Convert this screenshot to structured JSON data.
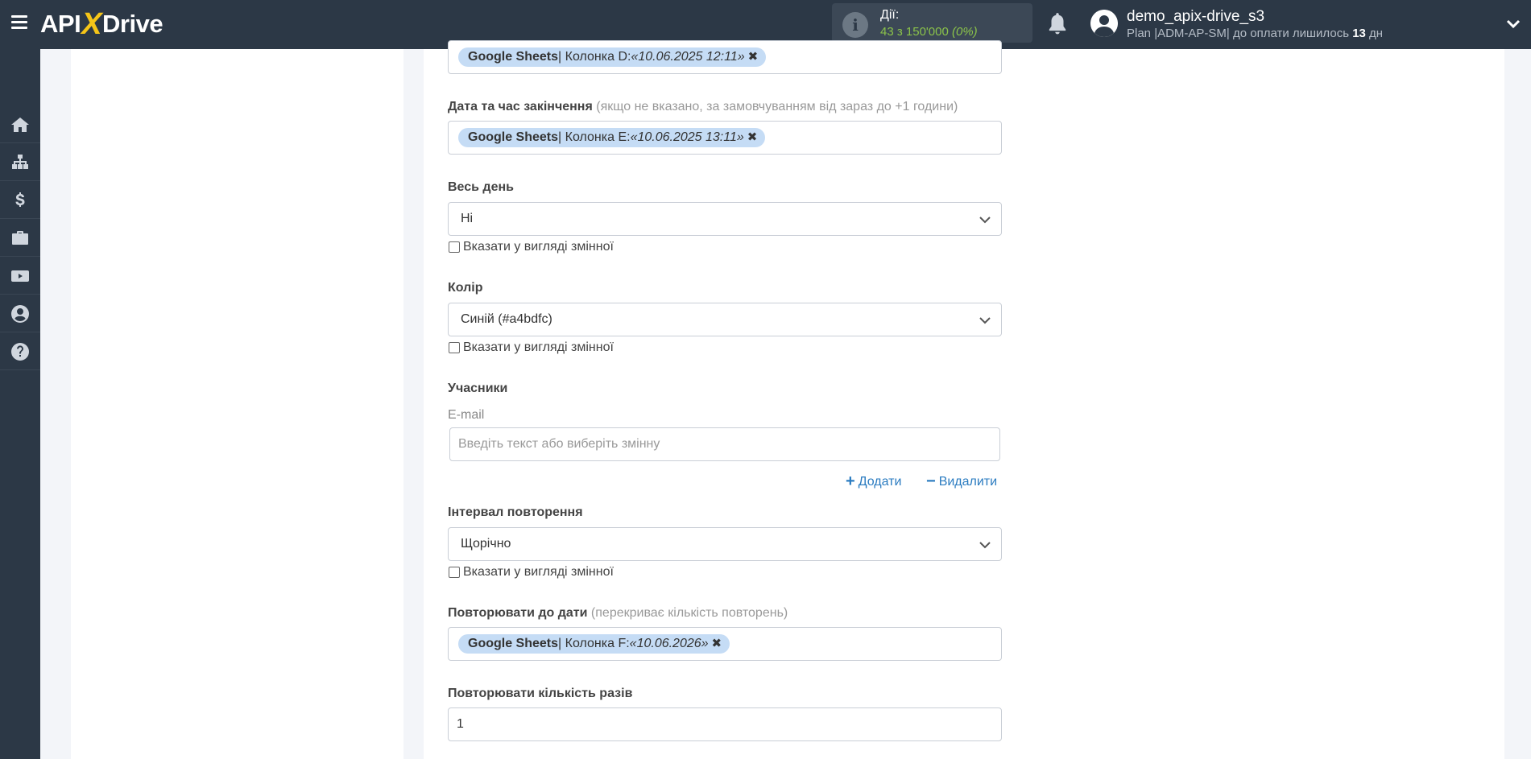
{
  "header": {
    "logo_left": "API",
    "logo_x": "X",
    "logo_right": "Drive",
    "actions_title": "Дії:",
    "actions_count": "43 з 150'000",
    "actions_percent": "(0%)",
    "user_name": "demo_apix-drive_s3",
    "plan_prefix": "Plan |ADM-AP-SM| до оплати лишилось",
    "plan_days": "13",
    "plan_suffix": "дн"
  },
  "sidebar": {
    "items": [
      "home-icon",
      "sitemap-icon",
      "dollar-icon",
      "briefcase-icon",
      "youtube-icon",
      "user-icon",
      "help-icon"
    ]
  },
  "form": {
    "start_tag": {
      "source": "Google Sheets",
      "column": " | Колонка D: ",
      "value": "«10.06.2025 12:11»"
    },
    "end_label": "Дата та час закінчення",
    "end_hint": " (якщо не вказано, за замовчуванням від зараз до +1 години)",
    "end_tag": {
      "source": "Google Sheets",
      "column": " | Колонка E: ",
      "value": "«10.06.2025 13:11»"
    },
    "allday_label": "Весь день",
    "allday_value": "Ні",
    "as_variable": "Вказати у вигляді змінної",
    "color_label": "Колір",
    "color_value": "Синій (#a4bdfc)",
    "attendees_label": "Учасники",
    "email_label": "E-mail",
    "email_placeholder": "Введіть текст або виберіть змінну",
    "add_label": "Додати",
    "remove_label": "Видалити",
    "repeat_label": "Інтервал повторення",
    "repeat_value": "Щорічно",
    "until_label": "Повторювати до дати",
    "until_hint": " (перекриває кількість повторень)",
    "until_tag": {
      "source": "Google Sheets",
      "column": " | Колонка F: ",
      "value": "«10.06.2026»"
    },
    "count_label": "Повторювати кількість разів",
    "count_value": "1"
  },
  "colors": {
    "topbar": "#2c3846",
    "tag": "#c5dcf5",
    "link": "#2a7bc0",
    "actions_green": "#8bc34a"
  }
}
